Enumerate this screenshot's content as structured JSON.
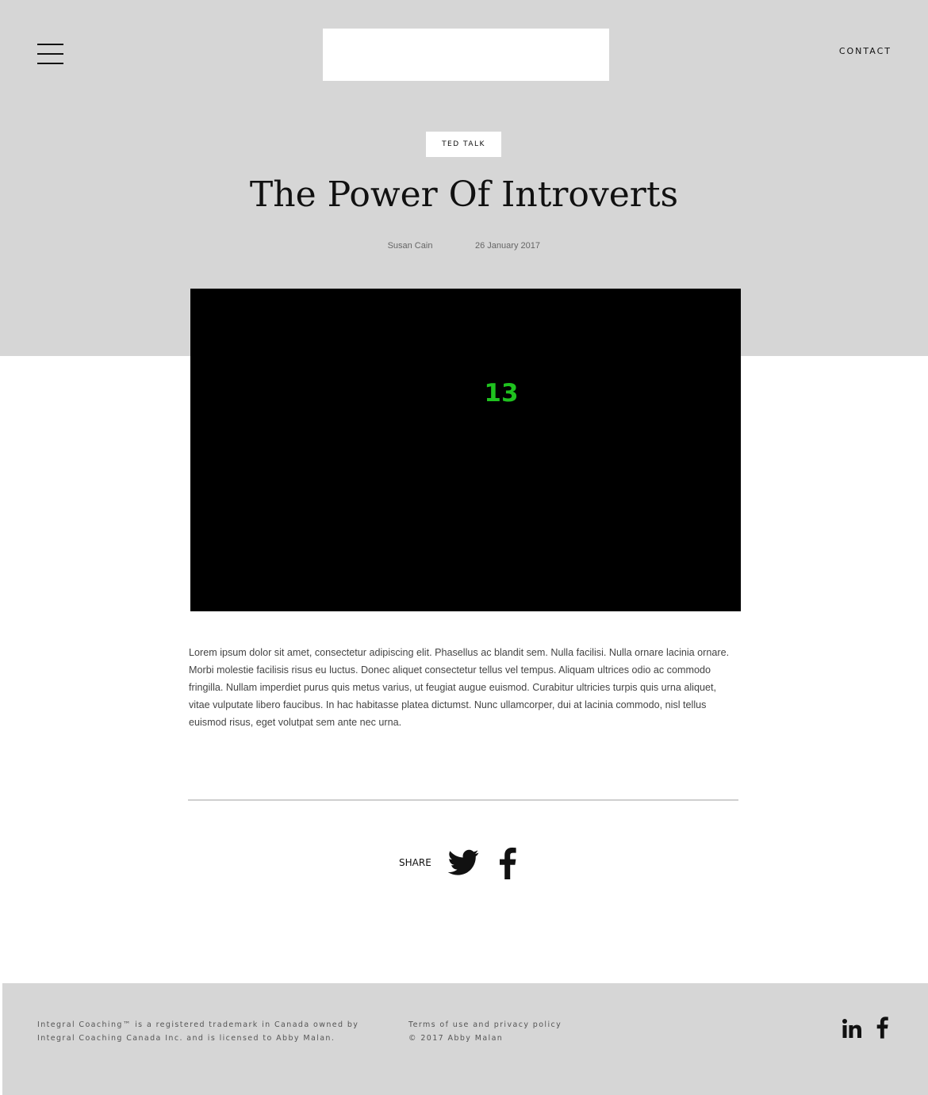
{
  "header": {
    "contact_label": "CONTACT"
  },
  "post": {
    "category": "TED TALK",
    "title": "The Power Of Introverts",
    "author": "Susan Cain",
    "date": "26 January 2017",
    "video_overlay_text": "13",
    "body": "Lorem ipsum dolor sit amet, consectetur adipiscing elit. Phasellus ac blandit sem. Nulla facilisi. Nulla ornare lacinia ornare. Morbi molestie facilisis risus eu luctus. Donec aliquet consectetur tellus vel tempus. Aliquam ultrices odio ac commodo fringilla. Nullam imperdiet purus quis metus varius, ut feugiat augue euismod. Curabitur ultricies turpis quis urna aliquet, vitae vulputate libero faucibus. In hac habitasse platea dictumst. Nunc ullamcorper, dui at lacinia commodo, nisl tellus euismod risus, eget volutpat sem ante nec urna."
  },
  "share": {
    "label": "SHARE",
    "icons": [
      "twitter-icon",
      "facebook-icon"
    ]
  },
  "footer": {
    "legal_line1": "Integral Coaching™ is a registered trademark in Canada owned by",
    "legal_line2": "Integral Coaching Canada Inc. and is licensed to Abby Malan.",
    "terms_link": "Terms of use and privacy policy",
    "copyright": "© 2017 Abby Malan",
    "social_icons": [
      "linkedin-icon",
      "facebook-icon"
    ]
  },
  "colors": {
    "hero_background": "#d6d6d6",
    "footer_background": "#d6d6d6",
    "video_background": "#000000",
    "overlay_text": "#1fc21f"
  }
}
